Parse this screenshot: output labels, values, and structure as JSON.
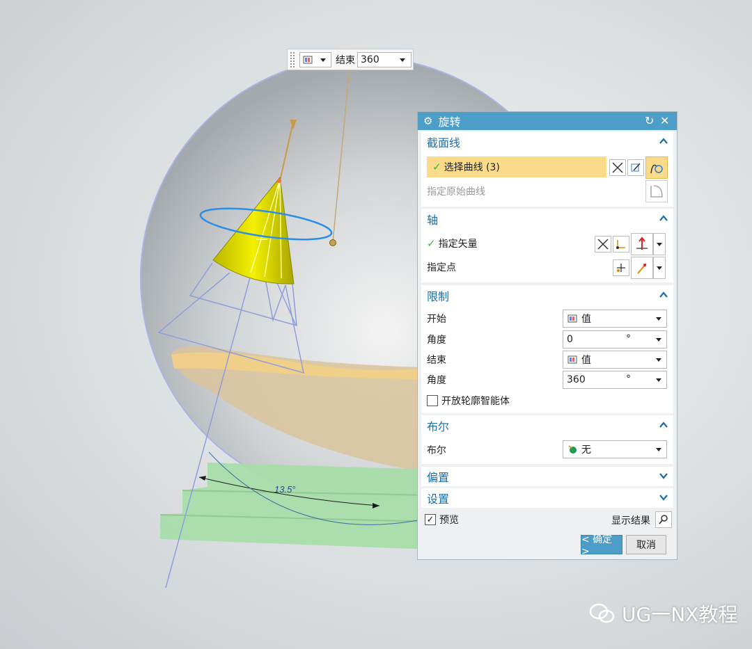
{
  "mini_toolbar": {
    "end_label": "结束",
    "end_value": "360"
  },
  "viewport": {
    "dimension_text": "13.5°"
  },
  "dialog": {
    "title": "旋转",
    "title_icons": [
      "gear-icon",
      "reset-icon",
      "close-icon"
    ],
    "section_curve": {
      "title": "截面线",
      "select_curve": "选择曲线 (3)",
      "specify_origin_curve": "指定原始曲线"
    },
    "section_axis": {
      "title": "轴",
      "specify_vector": "指定矢量",
      "specify_point": "指定点"
    },
    "section_limits": {
      "title": "限制",
      "start_label": "开始",
      "start_value": "值",
      "start_angle_label": "角度",
      "start_angle_value": "0",
      "end_label": "结束",
      "end_value": "值",
      "end_angle_label": "角度",
      "end_angle_value": "360",
      "unit": "°",
      "open_profile": "开放轮廓智能体"
    },
    "section_boolean": {
      "title": "布尔",
      "boolean_label": "布尔",
      "boolean_value": "无"
    },
    "section_offset": {
      "title": "偏置"
    },
    "section_settings": {
      "title": "设置"
    },
    "preview_label": "预览",
    "show_result": "显示结果",
    "ok": "< 确定 >",
    "cancel": "取消"
  },
  "watermark": "UG一NX教程",
  "colors": {
    "title_bar": "#4d9dc9",
    "section_title": "#1b6fa8",
    "highlight": "#fadb8a"
  }
}
